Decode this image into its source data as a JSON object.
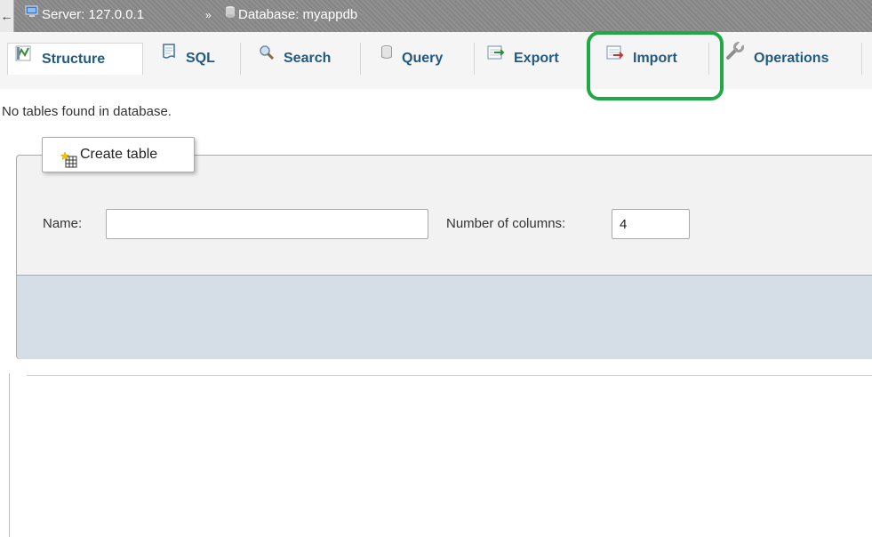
{
  "breadcrumb": {
    "back": "←",
    "server_label": "Server: 127.0.0.1",
    "separator": "»",
    "database_label": "Database: myappdb"
  },
  "tabs": [
    {
      "label": "Structure",
      "icon": "structure-icon",
      "active": true
    },
    {
      "label": "SQL",
      "icon": "sql-icon",
      "active": false
    },
    {
      "label": "Search",
      "icon": "search-icon",
      "active": false
    },
    {
      "label": "Query",
      "icon": "query-icon",
      "active": false
    },
    {
      "label": "Export",
      "icon": "export-icon",
      "active": false
    },
    {
      "label": "Import",
      "icon": "import-icon",
      "active": false,
      "highlighted": true
    },
    {
      "label": "Operations",
      "icon": "wrench-icon",
      "active": false
    }
  ],
  "notice": "No tables found in database.",
  "create_table": {
    "legend": "Create table",
    "name_label": "Name:",
    "name_value": "",
    "columns_label": "Number of columns:",
    "columns_value": "4"
  },
  "colors": {
    "tab_text": "#235a81",
    "highlight": "#1fa845",
    "footer_bg": "#d5dde6",
    "topbar_bg": "#8a8a8a"
  }
}
